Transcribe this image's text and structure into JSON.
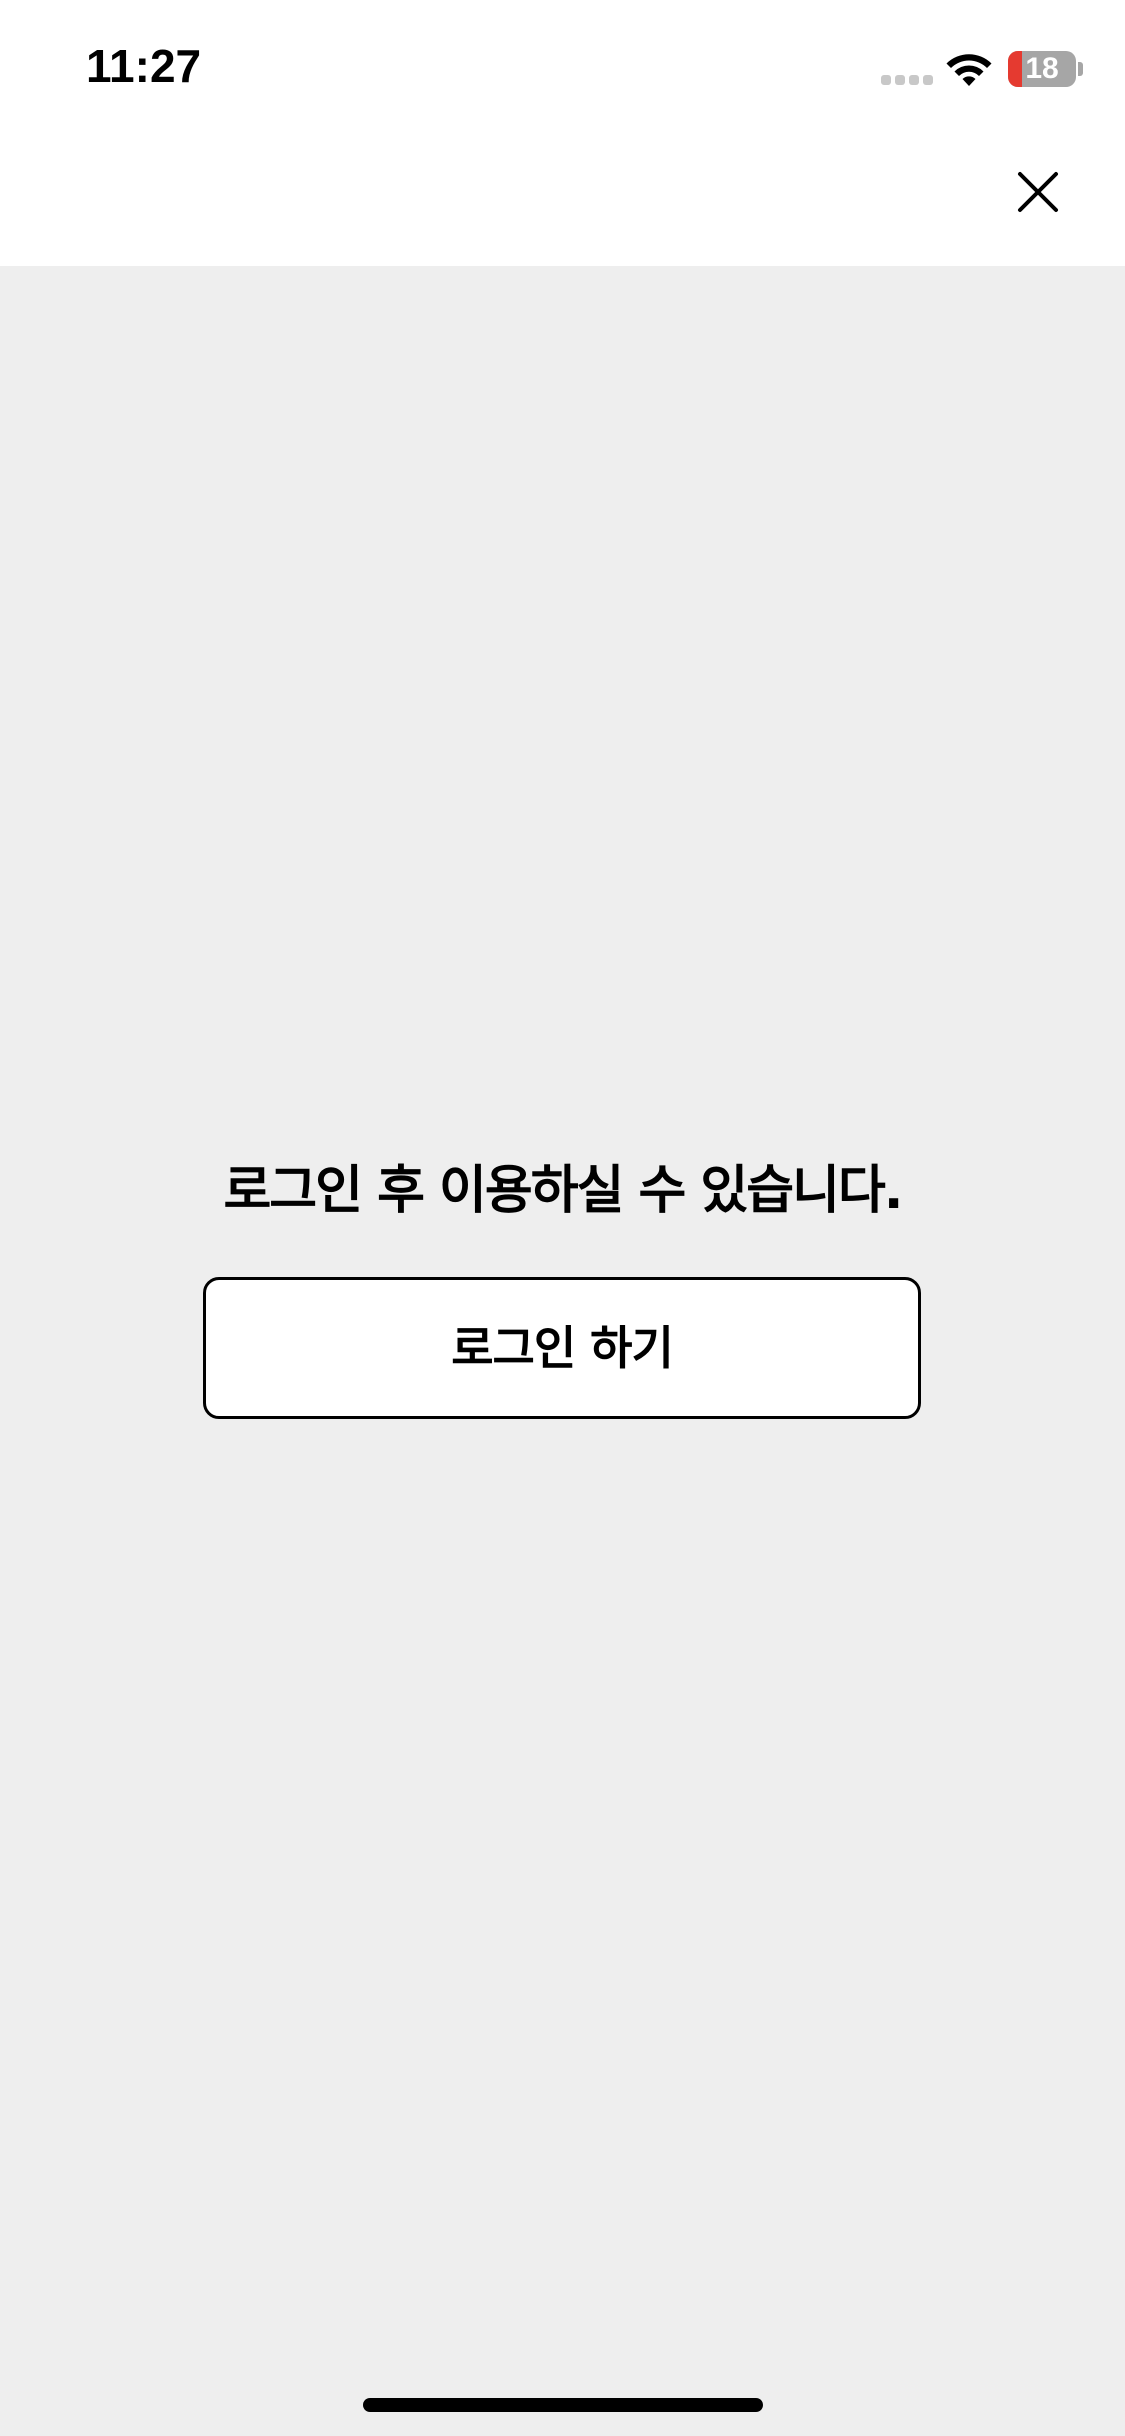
{
  "status_bar": {
    "time": "11:27",
    "battery_level": "18",
    "signal_icon": "cellular-signal-icon",
    "wifi_icon": "wifi-icon",
    "battery_icon": "battery-icon"
  },
  "nav": {
    "close_icon": "close-icon"
  },
  "main": {
    "message": "로그인 후 이용하실 수 있습니다.",
    "login_button_label": "로그인 하기"
  },
  "colors": {
    "background": "#eeeeee",
    "surface": "#ffffff",
    "text": "#000000",
    "battery_low": "#e53a30",
    "battery_body": "#a6a6a6"
  }
}
